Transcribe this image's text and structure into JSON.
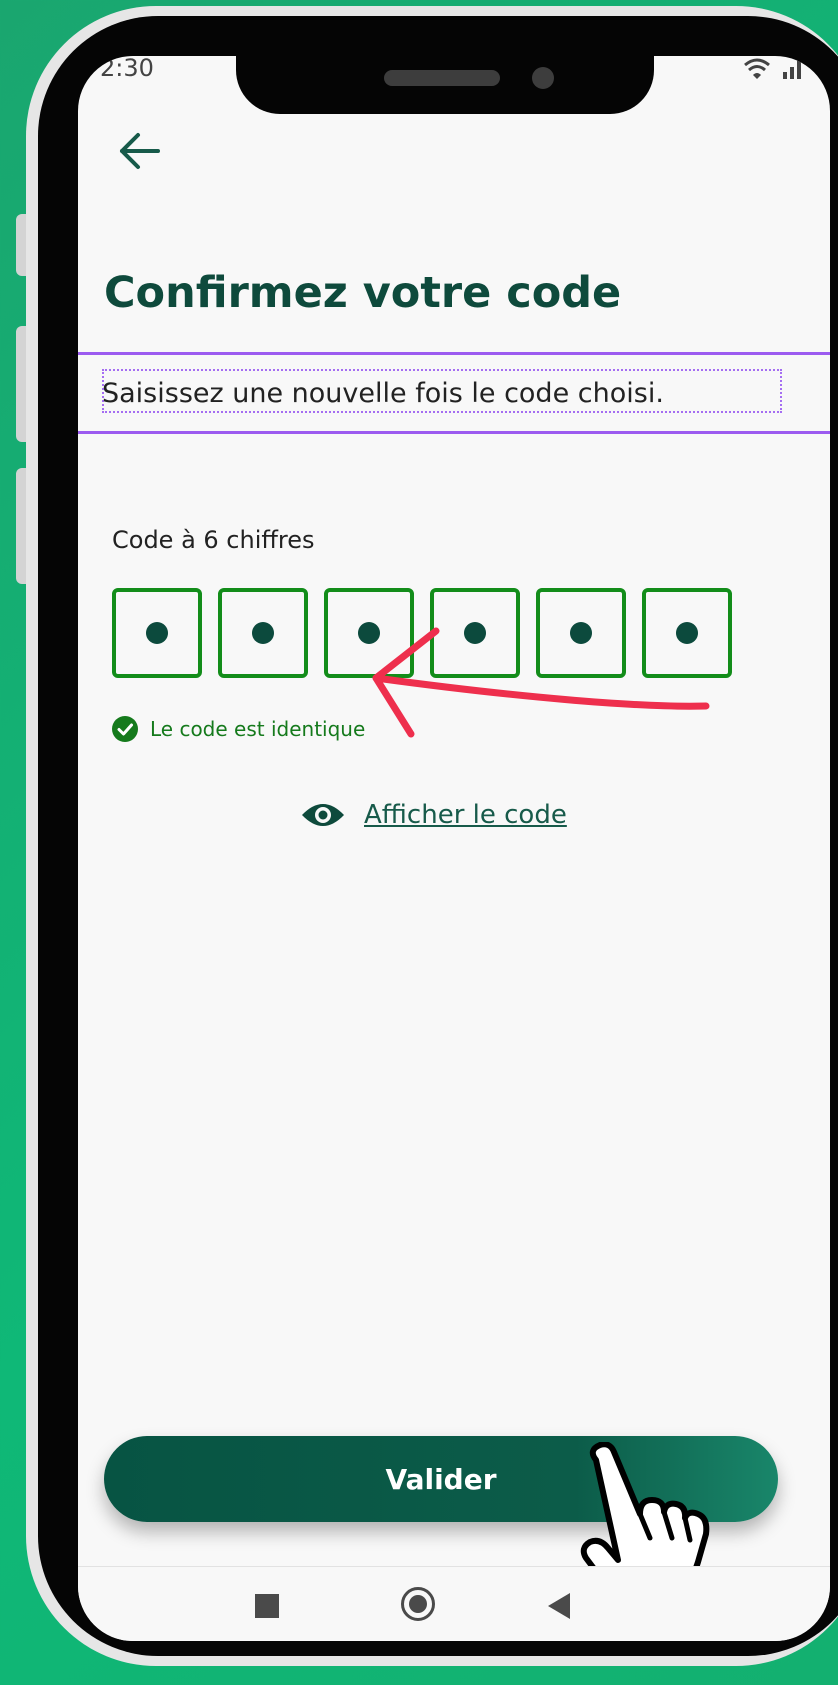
{
  "status_bar": {
    "time": "2:30"
  },
  "header": {
    "back_icon": "arrow-left-icon"
  },
  "page": {
    "title": "Confirmez votre code",
    "subtitle": "Saisissez une nouvelle fois le code choisi."
  },
  "code_entry": {
    "label": "Code à 6 chiffres",
    "digits": [
      "•",
      "•",
      "•",
      "•",
      "•",
      "•"
    ],
    "border_color": "#138d1a",
    "match_icon": "check-circle-icon",
    "match_message": "Le code est identique",
    "show_code_icon": "eye-icon",
    "show_code_label": "Afficher le code"
  },
  "validate_button": {
    "label": "Valider"
  },
  "annotations": {
    "arrow_color": "#ee2f4d",
    "pointer": "hand-pointer-icon"
  },
  "colors": {
    "primary": "#0e4a3c",
    "success": "#157a1c",
    "highlight": "#9c5bf0"
  }
}
